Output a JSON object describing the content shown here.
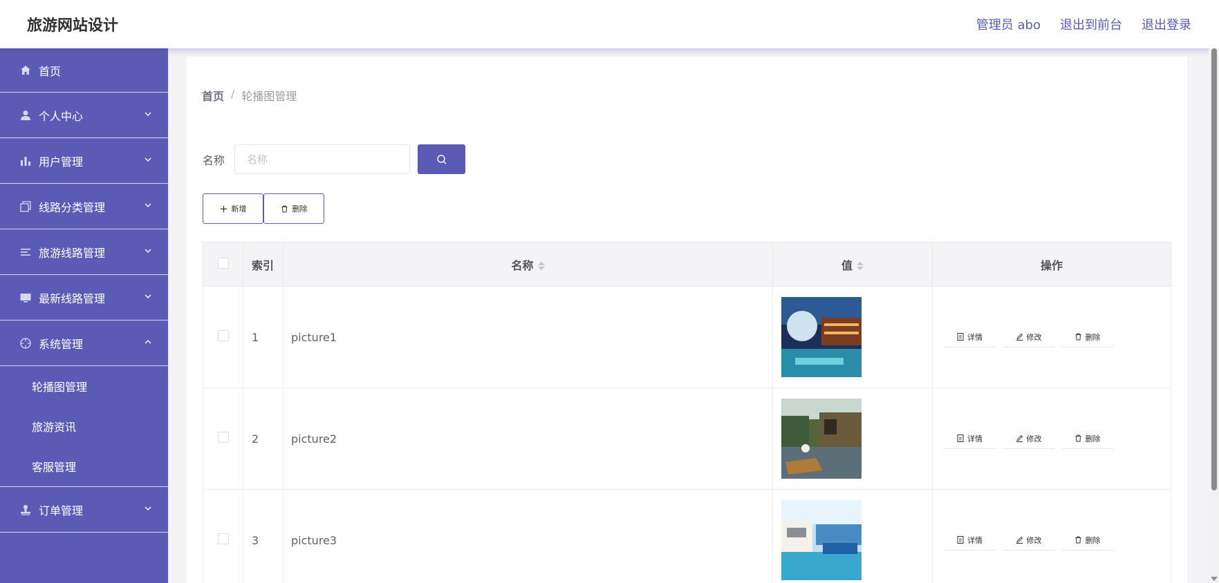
{
  "header": {
    "brand": "旅游网站设计",
    "admin_label": "管理员 abo",
    "to_front_label": "退出到前台",
    "logout_label": "退出登录"
  },
  "sidebar": {
    "items": [
      {
        "label": "首页",
        "icon": "home-icon"
      },
      {
        "label": "个人中心",
        "icon": "user-icon"
      },
      {
        "label": "用户管理",
        "icon": "bar-chart-icon"
      },
      {
        "label": "线路分类管理",
        "icon": "copy-icon"
      },
      {
        "label": "旅游线路管理",
        "icon": "list-icon"
      },
      {
        "label": "最新线路管理",
        "icon": "monitor-icon"
      },
      {
        "label": "系统管理",
        "icon": "crosshair-icon"
      },
      {
        "label": "订单管理",
        "icon": "stamp-icon"
      }
    ],
    "system_sub": [
      "轮播图管理",
      "旅游资讯",
      "客服管理"
    ]
  },
  "breadcrumb": {
    "home": "首页",
    "separator": "/",
    "current": "轮播图管理"
  },
  "search": {
    "label": "名称",
    "placeholder": "名称"
  },
  "actions": {
    "add_label": "新增",
    "delete_label": "删除"
  },
  "table": {
    "headers": {
      "index": "索引",
      "name": "名称",
      "value": "值",
      "ops": "操作"
    },
    "rows": [
      {
        "index": "1",
        "name": "picture1"
      },
      {
        "index": "2",
        "name": "picture2"
      },
      {
        "index": "3",
        "name": "picture3"
      }
    ],
    "ops": {
      "detail": "详情",
      "edit": "修改",
      "delete": "删除"
    }
  },
  "colors": {
    "primary": "#5b5bb6",
    "background": "#f4f4f6"
  }
}
